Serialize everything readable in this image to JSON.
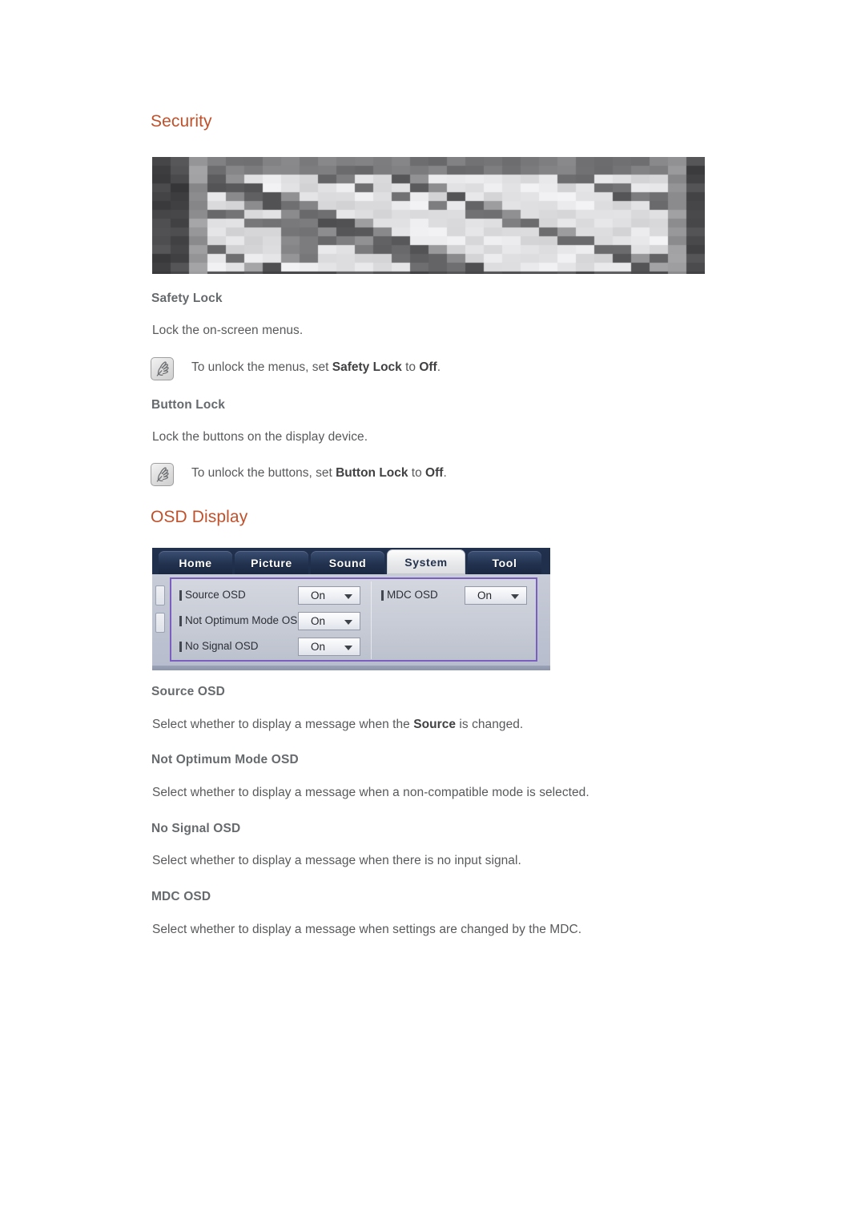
{
  "page": {
    "background": "#ffffff",
    "heading_color": "#c0512b",
    "text_color": "#58595b"
  },
  "sections": [
    {
      "id": "security",
      "heading": "Security",
      "items": [
        {
          "title": "Safety Lock",
          "description": "Lock the on-screen menus.",
          "note": {
            "icon": "note-hand-icon",
            "prefix": "To unlock the menus, set ",
            "strong1": "Safety Lock",
            "middle": " to ",
            "strong2": "Off",
            "suffix": "."
          }
        },
        {
          "title": "Button Lock",
          "description": "Lock the buttons on the display device.",
          "note": {
            "icon": "note-hand-icon",
            "prefix": "To unlock the buttons, set ",
            "strong1": "Button Lock",
            "middle": " to ",
            "strong2": "Off",
            "suffix": "."
          }
        }
      ]
    },
    {
      "id": "osd-display",
      "heading": "OSD Display",
      "items": [
        {
          "title": "Source OSD",
          "desc_prefix": "Select whether to display a message when the ",
          "desc_strong": "Source",
          "desc_suffix": " is changed."
        },
        {
          "title": "Not Optimum Mode OSD",
          "description": "Select whether to display a message when a non-compatible mode is selected."
        },
        {
          "title": "No Signal OSD",
          "description": "Select whether to display a message when there is no input signal."
        },
        {
          "title": "MDC OSD",
          "description": "Select whether to display a message when settings are changed by the MDC."
        }
      ]
    }
  ],
  "redacted_image": {
    "name": "security-menu-screenshot",
    "state": "pixelated"
  },
  "osd_menu": {
    "tabs": [
      {
        "label": "Home",
        "active": false
      },
      {
        "label": "Picture",
        "active": false
      },
      {
        "label": "Sound",
        "active": false
      },
      {
        "label": "System",
        "active": true
      },
      {
        "label": "Tool",
        "active": false
      }
    ],
    "left_column": [
      {
        "label": "Source OSD",
        "value": "On"
      },
      {
        "label": "Not Optimum Mode OSD",
        "value": "On"
      },
      {
        "label": "No Signal OSD",
        "value": "On"
      }
    ],
    "right_column": [
      {
        "label": "MDC OSD",
        "value": "On"
      }
    ],
    "highlight_color": "#7a5fc0",
    "active_tab_color": "#eeeff1"
  }
}
